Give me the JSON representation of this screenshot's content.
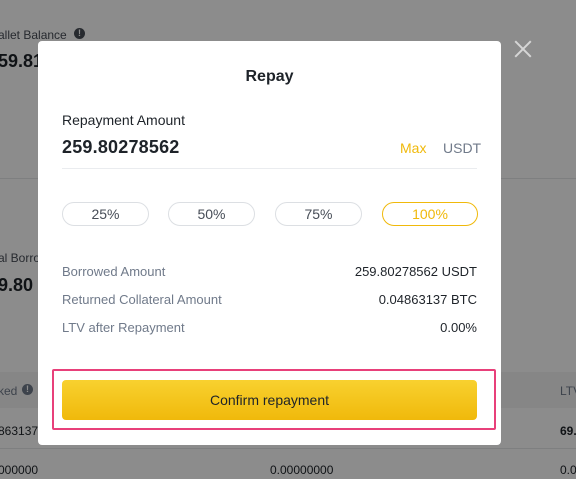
{
  "background": {
    "wallet_balance_label": "allet Balance",
    "wallet_balance_value": "59.81",
    "total_borrowed_label": "al Borro",
    "total_borrowed_value": "9.80",
    "table_header_left": "ked",
    "table_header_right": "LTV",
    "row1_left": "863137",
    "row1_right": "69.",
    "row2_left": "000000",
    "row2_mid": "0.00000000",
    "row2_right": "0.0"
  },
  "modal": {
    "title": "Repay",
    "amount_label": "Repayment Amount",
    "amount_value": "259.80278562",
    "max_label": "Max",
    "unit": "USDT",
    "percentages": [
      {
        "label": "25%",
        "active": false
      },
      {
        "label": "50%",
        "active": false
      },
      {
        "label": "75%",
        "active": false
      },
      {
        "label": "100%",
        "active": true
      }
    ],
    "details": [
      {
        "label": "Borrowed Amount",
        "value": "259.80278562 USDT"
      },
      {
        "label": "Returned Collateral Amount",
        "value": "0.04863137 BTC"
      },
      {
        "label": "LTV after Repayment",
        "value": "0.00%"
      }
    ],
    "confirm_label": "Confirm repayment"
  },
  "colors": {
    "accent": "#f0b90b",
    "highlight_border": "#e8407a",
    "overlay": "rgba(0,0,0,0.45)"
  },
  "icons": [
    "info-icon",
    "close-icon"
  ]
}
